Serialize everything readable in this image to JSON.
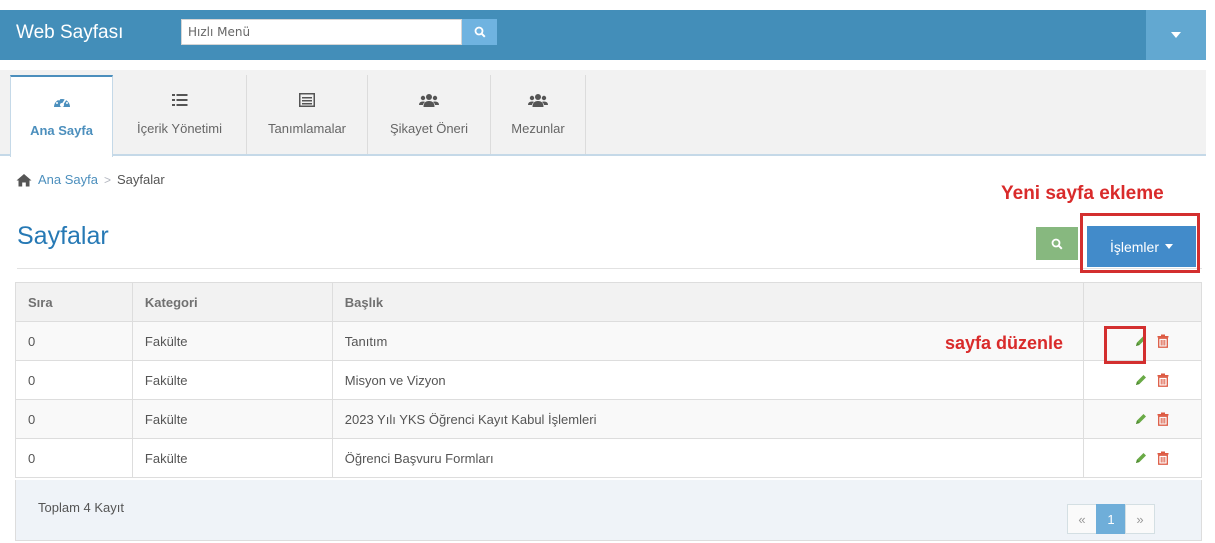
{
  "header": {
    "brand": "Web Sayfası",
    "search_placeholder": "Hızlı Menü"
  },
  "nav": {
    "items": [
      {
        "label": "Ana Sayfa",
        "icon": "dashboard-icon",
        "active": true
      },
      {
        "label": "İçerik Yönetimi",
        "icon": "list-icon"
      },
      {
        "label": "Tanımlamalar",
        "icon": "list-alt-icon"
      },
      {
        "label": "Şikayet Öneri",
        "icon": "users-icon"
      },
      {
        "label": "Mezunlar",
        "icon": "users-icon"
      }
    ]
  },
  "breadcrumb": {
    "home": "Ana Sayfa",
    "separator": ">",
    "current": "Sayfalar"
  },
  "page": {
    "title": "Sayfalar",
    "actions_label": "İşlemler"
  },
  "annotations": {
    "new_page": "Yeni sayfa ekleme",
    "edit_page": "sayfa düzenle"
  },
  "table": {
    "headers": [
      "Sıra",
      "Kategori",
      "Başlık",
      ""
    ],
    "rows": [
      {
        "sira": "0",
        "kategori": "Fakülte",
        "baslik": "Tanıtım"
      },
      {
        "sira": "0",
        "kategori": "Fakülte",
        "baslik": "Misyon ve Vizyon"
      },
      {
        "sira": "0",
        "kategori": "Fakülte",
        "baslik": "2023 Yılı YKS Öğrenci Kayıt Kabul İşlemleri"
      },
      {
        "sira": "0",
        "kategori": "Fakülte",
        "baslik": "Öğrenci Başvuru Formları"
      }
    ]
  },
  "footer": {
    "total": "Toplam 4 Kayıt",
    "pager": {
      "prev": "«",
      "current": "1",
      "next": "»"
    }
  },
  "colors": {
    "header_bg": "#438eb9",
    "accent": "#428bca",
    "edit_icon": "#69aa46",
    "delete_icon": "#dd5a43",
    "annotation": "#d92b2b"
  }
}
